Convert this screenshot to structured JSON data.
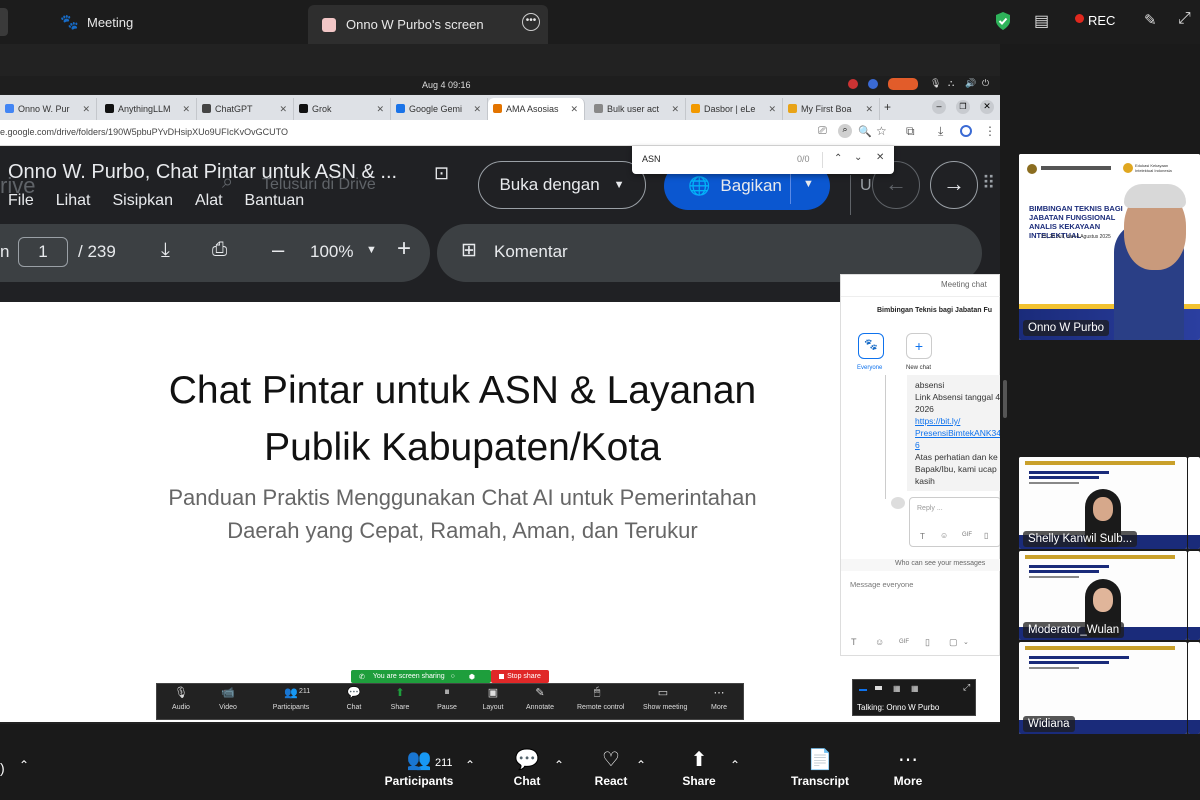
{
  "zoom_top": {
    "meeting_label": "Meeting",
    "share_label": "Onno W Purbo's screen",
    "rec_label": "REC"
  },
  "ubuntu": {
    "datetime": "Aug 4  09:16"
  },
  "chrome": {
    "tabs": [
      {
        "label": "Onno W. Pur",
        "color": "#4285f4"
      },
      {
        "label": "AnythingLLM",
        "color": "#111"
      },
      {
        "label": "ChatGPT",
        "color": "#444"
      },
      {
        "label": "Grok",
        "color": "#111"
      },
      {
        "label": "Google Gemi",
        "color": "#1a73e8"
      },
      {
        "label": "AMA Asosias",
        "color": "#e37400"
      },
      {
        "label": "Bulk user act",
        "color": "#888"
      },
      {
        "label": "Dasbor | eLe",
        "color": "#f29900"
      },
      {
        "label": "My First Boa",
        "color": "#e8a317"
      }
    ],
    "new_tab": "+",
    "url": "e.google.com/drive/folders/190W5pbuPYvDHsipXUo9UFIcKvOvGCUTO"
  },
  "find_bar": {
    "query": "ASN",
    "count": "0/0"
  },
  "drive": {
    "logo_partial": "rive",
    "search_placeholder": "Telusuri di Drive",
    "open_with": "Buka dengan",
    "share": "Bagikan",
    "letter": "U",
    "doc_title": "Onno W. Purbo, Chat Pintar untuk ASN & ...",
    "menu": [
      "File",
      "Lihat",
      "Sisipkan",
      "Alat",
      "Bantuan"
    ],
    "page_prefix": "n",
    "page_current": "1",
    "page_total": "/  239",
    "zoom": "100%",
    "comment": "Komentar"
  },
  "slide": {
    "title_line1": "Chat Pintar untuk ASN & Layanan",
    "title_line2": "Publik Kabupaten/Kota",
    "subtitle_line1": "Panduan Praktis Menggunakan Chat AI untuk Pemerintahan",
    "subtitle_line2": "Daerah yang Cepat, Ramah, Aman, dan Terukur"
  },
  "sharing_bar": {
    "status": "You are screen sharing",
    "stop": "Stop share"
  },
  "share_toolbar": {
    "items": [
      {
        "label": "Audio",
        "icon": "🎙"
      },
      {
        "label": "Video",
        "icon": "📹"
      },
      {
        "label": "Participants",
        "icon": "👥",
        "badge": "211"
      },
      {
        "label": "Chat",
        "icon": "💬"
      },
      {
        "label": "Share",
        "icon": "⬆"
      },
      {
        "label": "Pause",
        "icon": "⏸"
      },
      {
        "label": "Layout",
        "icon": "▣"
      },
      {
        "label": "Annotate",
        "icon": "✎"
      },
      {
        "label": "Remote control",
        "icon": "🖱"
      },
      {
        "label": "Show meeting",
        "icon": "▭"
      },
      {
        "label": "More",
        "icon": "⋯"
      }
    ]
  },
  "meeting_chat": {
    "title": "Meeting chat",
    "group_name": "Bimbingan Teknis bagi Jabatan Fu",
    "everyone": "Everyone",
    "new_chat": "New chat",
    "msg_lines": [
      "absensi",
      "Link Absensi tanggal 4",
      "2026"
    ],
    "link1": "https://bit.ly/",
    "link2": "PresensiBimtekANK34",
    "link3": "6",
    "msg_tail": [
      "Atas perhatian dan ke",
      "Bapak/Ibu, kami ucap",
      "kasih"
    ],
    "reply_placeholder": "Reply ...",
    "who_can_see": "Who can see your messages",
    "message_placeholder": "Message everyone"
  },
  "mini_window": {
    "talking": "Talking: Onno W Purbo"
  },
  "participants": [
    {
      "name": "Onno W Purbo"
    },
    {
      "name": "Shelly Kanwil Sulb..."
    },
    {
      "name": "Moderator_Wulan"
    },
    {
      "name": "Widiana"
    }
  ],
  "thumb_slide": {
    "title": "BIMBINGAN TEKNIS BAGI JABATAN FUNGSIONAL ANALIS KEKAYAAN INTELEKTUAL",
    "dates": "23, 28 Juli, dan 4 Agustus 2025",
    "logo_text": "Edukasi Kekayaan Intelektual Indonesia"
  },
  "zoom_bottom": {
    "participants_badge": "211",
    "items": [
      {
        "label": "Participants",
        "icon": "👥"
      },
      {
        "label": "Chat",
        "icon": "💬"
      },
      {
        "label": "React",
        "icon": "♡"
      },
      {
        "label": "Share",
        "icon": "⬆"
      },
      {
        "label": "Transcript",
        "icon": "📄"
      },
      {
        "label": "More",
        "icon": "⋯"
      }
    ]
  }
}
